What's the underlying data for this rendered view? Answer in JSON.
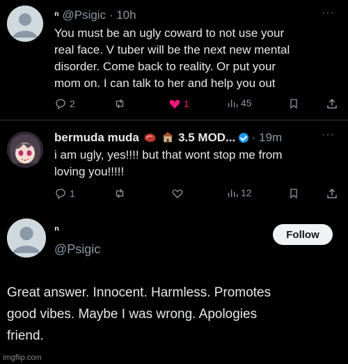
{
  "tweet1": {
    "display_name": "ⁿ",
    "handle": "@Psigic",
    "separator": "·",
    "time": "10h",
    "more": "···",
    "lines": [
      "You must be an ugly coward to not use your",
      "real face. V tuber will be the next new mental",
      "disorder. Come back to reality. Or put your",
      "mom on. I can talk to her and help you out"
    ],
    "replies": "2",
    "retweets": "",
    "likes": "1",
    "views": "45"
  },
  "tweet2": {
    "display_name": "bermuda muda",
    "name_extra": "3.5 MOD...",
    "separator": "·",
    "time": "19m",
    "more": "···",
    "lines": [
      "i am ugly, yes!!!! but that wont stop me from",
      "loving you!!!!!"
    ],
    "replies": "1",
    "retweets": "",
    "likes": "",
    "views": "12"
  },
  "profile": {
    "display_name": "ⁿ",
    "handle": "@Psigic",
    "follow_label": "Follow"
  },
  "caption": {
    "lines": [
      "Great answer. Innocent. Harmless. Promotes",
      "good vibes. Maybe I was wrong. Apologies",
      "friend."
    ]
  },
  "watermark": "imgflip.com",
  "colors": {
    "background": "#000000",
    "text": "#e7e9ea",
    "muted": "#8b98a5",
    "like": "#f91880",
    "verified": "#1d9bf0",
    "follow_bg": "#eff3f4"
  },
  "icons": [
    "reply-icon",
    "retweet-icon",
    "heart-icon",
    "views-icon",
    "bookmark-icon",
    "share-icon",
    "verified-icon",
    "more-icon"
  ]
}
